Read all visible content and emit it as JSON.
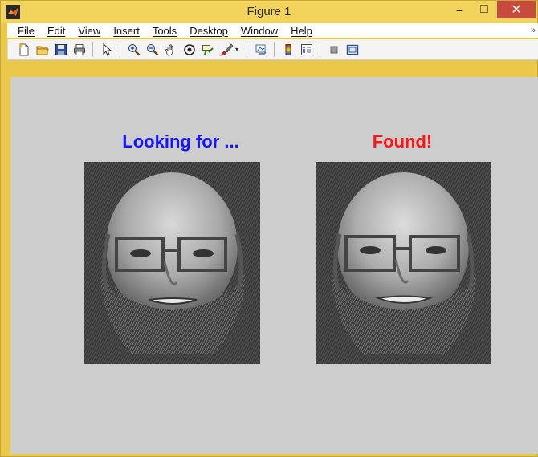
{
  "window": {
    "title": "Figure 1",
    "minimize_glyph": "–",
    "maximize_glyph": "□",
    "close_glyph": "✕"
  },
  "menu": {
    "items": [
      "File",
      "Edit",
      "View",
      "Insert",
      "Tools",
      "Desktop",
      "Window",
      "Help"
    ],
    "overflow_glyph": "»"
  },
  "toolbar": {
    "icons": [
      "new-figure-icon",
      "open-file-icon",
      "save-icon",
      "print-icon",
      "pointer-icon",
      "zoom-in-icon",
      "zoom-out-icon",
      "pan-icon",
      "rotate-3d-icon",
      "data-cursor-icon",
      "brush-icon",
      "link-plot-icon",
      "colorbar-icon",
      "legend-icon",
      "hide-plot-tools-icon",
      "show-plot-tools-icon"
    ]
  },
  "figure": {
    "left_title": "Looking for ...",
    "right_title": "Found!",
    "left_title_color": "#1414ff",
    "right_title_color": "#ff1414",
    "background_color": "#cdcdcd"
  }
}
